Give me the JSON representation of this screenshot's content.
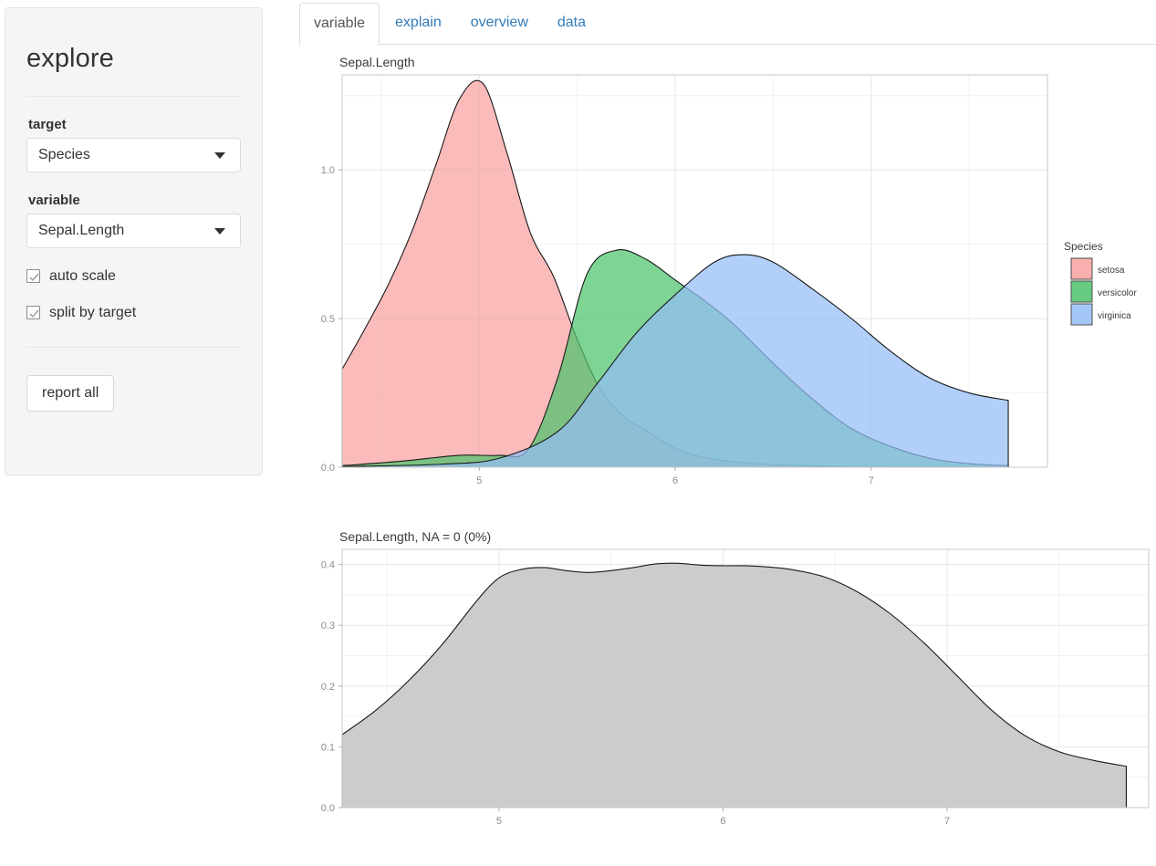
{
  "app": {
    "title": "explore"
  },
  "sidebar": {
    "target": {
      "label": "target",
      "value": "Species"
    },
    "variable": {
      "label": "variable",
      "value": "Sepal.Length"
    },
    "checkboxes": [
      {
        "label": "auto scale",
        "checked": true
      },
      {
        "label": "split by target",
        "checked": true
      }
    ],
    "report_button": "report all"
  },
  "tabs": [
    {
      "label": "variable",
      "active": true
    },
    {
      "label": "explain",
      "active": false
    },
    {
      "label": "overview",
      "active": false
    },
    {
      "label": "data",
      "active": false
    }
  ],
  "colors": {
    "setosa": "#F8A19F",
    "versicolor": "#4CC36C",
    "virginica": "#93BDF7",
    "gray_fill": "#CCCCCC",
    "line": "#222222",
    "grid_major": "#E6E6E6",
    "grid_minor": "#F2F2F2",
    "panel_border": "#C9C9C9",
    "tab_link": "#337ab7"
  },
  "chart_data": [
    {
      "type": "area",
      "title": "Sepal.Length",
      "xlabel": "",
      "ylabel": "",
      "grid": true,
      "legend": {
        "position": "right",
        "title": "Species",
        "entries": [
          {
            "name": "setosa",
            "color": "#F8A19F"
          },
          {
            "name": "versicolor",
            "color": "#4CC36C"
          },
          {
            "name": "virginica",
            "color": "#93BDF7"
          }
        ]
      },
      "xlim": [
        4.3,
        7.9
      ],
      "ylim": [
        0.0,
        1.32
      ],
      "xticks": [
        5,
        6,
        7
      ],
      "yticks": [
        0.0,
        0.5,
        1.0
      ],
      "series": [
        {
          "name": "setosa",
          "color": "#F8A19F",
          "x": [
            4.3,
            4.42,
            4.54,
            4.66,
            4.78,
            4.9,
            5.02,
            5.14,
            5.26,
            5.38,
            5.5,
            5.62,
            5.74,
            5.86,
            5.98,
            6.1,
            6.3,
            6.6,
            7.0,
            7.4,
            7.7
          ],
          "y": [
            0.33,
            0.47,
            0.62,
            0.8,
            1.02,
            1.24,
            1.29,
            1.06,
            0.79,
            0.64,
            0.43,
            0.26,
            0.17,
            0.12,
            0.07,
            0.04,
            0.018,
            0.006,
            0.002,
            0.001,
            0.0
          ]
        },
        {
          "name": "versicolor",
          "color": "#4CC36C",
          "x": [
            4.3,
            4.6,
            4.9,
            5.1,
            5.25,
            5.4,
            5.55,
            5.7,
            5.85,
            6.0,
            6.15,
            6.3,
            6.5,
            6.7,
            6.9,
            7.1,
            7.3,
            7.5,
            7.7
          ],
          "y": [
            0.005,
            0.02,
            0.04,
            0.04,
            0.06,
            0.3,
            0.65,
            0.73,
            0.7,
            0.63,
            0.56,
            0.48,
            0.35,
            0.23,
            0.13,
            0.07,
            0.03,
            0.012,
            0.005
          ]
        },
        {
          "name": "virginica",
          "color": "#93BDF7",
          "x": [
            4.3,
            4.8,
            5.1,
            5.4,
            5.6,
            5.8,
            6.0,
            6.2,
            6.35,
            6.5,
            6.7,
            6.9,
            7.1,
            7.3,
            7.5,
            7.7
          ],
          "y": [
            0.002,
            0.01,
            0.03,
            0.12,
            0.28,
            0.45,
            0.58,
            0.69,
            0.715,
            0.69,
            0.6,
            0.5,
            0.39,
            0.3,
            0.25,
            0.225
          ]
        }
      ]
    },
    {
      "type": "area",
      "title": "Sepal.Length, NA = 0 (0%)",
      "xlabel": "",
      "ylabel": "",
      "grid": true,
      "fill_color": "#CCCCCC",
      "xlim": [
        4.3,
        7.9
      ],
      "ylim": [
        0.0,
        0.425
      ],
      "xticks": [
        5,
        6,
        7
      ],
      "yticks": [
        0.0,
        0.1,
        0.2,
        0.3,
        0.4
      ],
      "x": [
        4.3,
        4.45,
        4.6,
        4.75,
        4.9,
        5.0,
        5.1,
        5.2,
        5.3,
        5.4,
        5.5,
        5.6,
        5.7,
        5.8,
        5.9,
        6.0,
        6.1,
        6.2,
        6.3,
        6.45,
        6.6,
        6.75,
        6.9,
        7.05,
        7.2,
        7.35,
        7.5,
        7.65,
        7.8
      ],
      "y": [
        0.12,
        0.16,
        0.21,
        0.27,
        0.34,
        0.378,
        0.392,
        0.395,
        0.39,
        0.387,
        0.39,
        0.395,
        0.401,
        0.402,
        0.399,
        0.398,
        0.398,
        0.396,
        0.392,
        0.38,
        0.355,
        0.318,
        0.27,
        0.215,
        0.16,
        0.118,
        0.092,
        0.078,
        0.068
      ]
    }
  ]
}
